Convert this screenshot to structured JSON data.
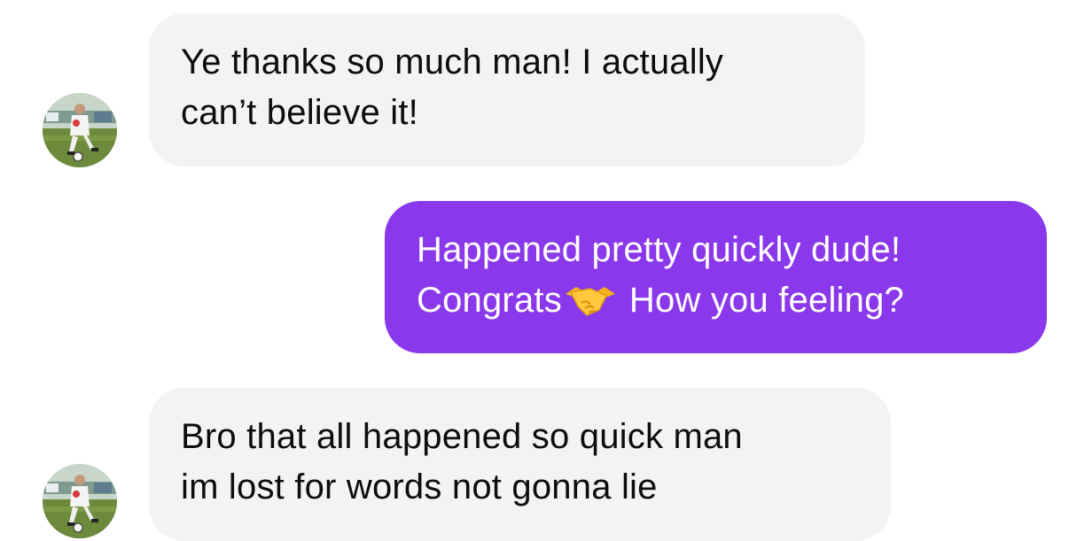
{
  "messages": [
    {
      "direction": "incoming",
      "lines": [
        "Ye thanks so much man! I actually",
        "can’t believe it!"
      ],
      "avatar_icon": "contact-avatar-soccer-player"
    },
    {
      "direction": "outgoing",
      "line1": "Happened pretty quickly dude!",
      "line2_before_emoji": "Congrats",
      "emoji_icon": "handshake-emoji",
      "line2_after_emoji": "How you feeling?"
    },
    {
      "direction": "incoming",
      "lines": [
        "Bro that all happened so quick man",
        "im lost for words not gonna lie"
      ],
      "avatar_icon": "contact-avatar-soccer-player"
    }
  ],
  "colors": {
    "incoming_bubble": "#f2f3f5",
    "incoming_text": "#0d0d0d",
    "outgoing_bubble": "#8a38eb",
    "outgoing_text": "#ffffff"
  }
}
